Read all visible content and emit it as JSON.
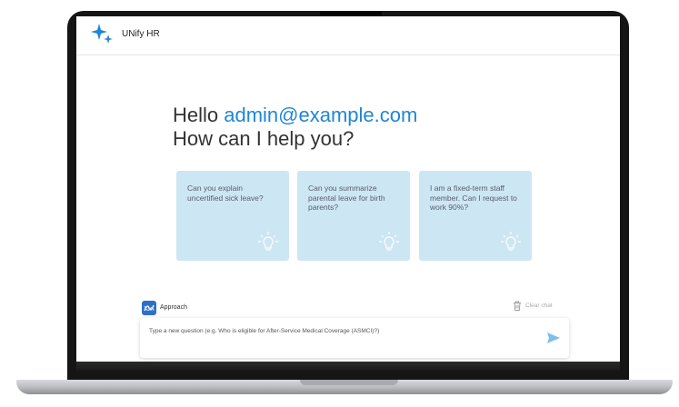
{
  "app": {
    "title": "UNify HR"
  },
  "greeting": {
    "prefix": "Hello ",
    "email": "admin@example.com",
    "question": "How can I help you?"
  },
  "examples": [
    {
      "text": "Can you explain uncertified sick leave?"
    },
    {
      "text": "Can you summarize parental leave for birth parents?"
    },
    {
      "text": "I am a fixed-term staff member. Can I request to work 90%?"
    }
  ],
  "controls": {
    "approach_label": "Approach",
    "clear_chat_label": "Clear chat"
  },
  "question_input": {
    "placeholder": "Type a new question (e.g. Who is eligible for After-Service Medical Coverage (ASMCI)?)"
  },
  "colors": {
    "accent": "#1f86d6",
    "card_bg": "#cde6f4",
    "send": "#7fc0ea"
  },
  "icons": [
    "sparkle-logo-icon",
    "lightbulb-icon",
    "approach-icon",
    "trash-icon",
    "send-icon"
  ]
}
